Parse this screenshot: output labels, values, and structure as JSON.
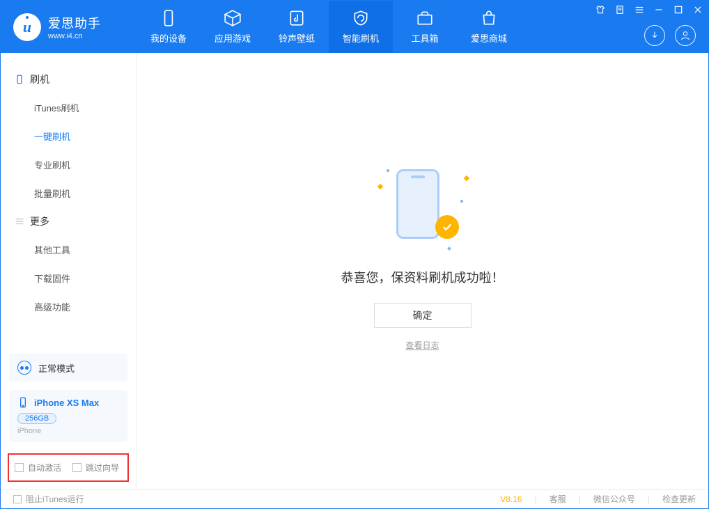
{
  "app": {
    "name_cn": "爱思助手",
    "name_en": "www.i4.cn"
  },
  "tabs": [
    {
      "label": "我的设备"
    },
    {
      "label": "应用游戏"
    },
    {
      "label": "铃声壁纸"
    },
    {
      "label": "智能刷机"
    },
    {
      "label": "工具箱"
    },
    {
      "label": "爱思商城"
    }
  ],
  "sidebar": {
    "group1": "刷机",
    "items1": [
      {
        "label": "iTunes刷机"
      },
      {
        "label": "一键刷机"
      },
      {
        "label": "专业刷机"
      },
      {
        "label": "批量刷机"
      }
    ],
    "group2": "更多",
    "items2": [
      {
        "label": "其他工具"
      },
      {
        "label": "下载固件"
      },
      {
        "label": "高级功能"
      }
    ]
  },
  "mode": {
    "label": "正常模式"
  },
  "device": {
    "name": "iPhone XS Max",
    "storage": "256GB",
    "type": "iPhone"
  },
  "options": {
    "auto_activate": "自动激活",
    "skip_guide": "跳过向导"
  },
  "main": {
    "success": "恭喜您，保资料刷机成功啦！",
    "ok": "确定",
    "view_log": "查看日志"
  },
  "footer": {
    "block_itunes": "阻止iTunes运行",
    "version": "V8.16",
    "service": "客服",
    "wechat": "微信公众号",
    "update": "检查更新"
  }
}
